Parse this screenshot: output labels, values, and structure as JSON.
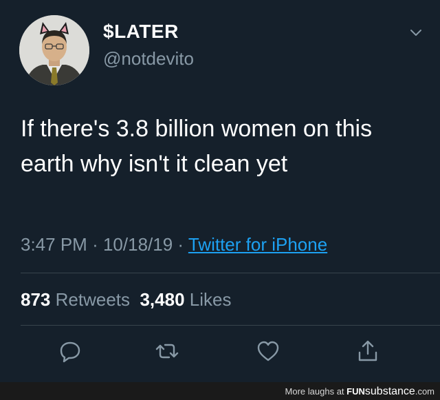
{
  "user": {
    "display_name": "$LATER",
    "handle": "@notdevito"
  },
  "tweet": {
    "text": "If there's 3.8 billion women on this earth why isn't it clean yet",
    "time": "3:47 PM",
    "date": "10/18/19",
    "separator": "·",
    "source": "Twitter for iPhone"
  },
  "stats": {
    "retweets_count": "873",
    "retweets_label": "Retweets",
    "likes_count": "3,480",
    "likes_label": "Likes"
  },
  "actions": [
    "reply-icon",
    "retweet-icon",
    "like-icon",
    "share-icon"
  ],
  "footer": {
    "prefix": "More laughs at",
    "brand_part1": "FUN",
    "brand_part2": "substance",
    "brand_suffix": ".com"
  },
  "colors": {
    "background": "#15202b",
    "text": "#ffffff",
    "secondary": "#8899a6",
    "link": "#1da1f2",
    "divider": "#38444d"
  }
}
